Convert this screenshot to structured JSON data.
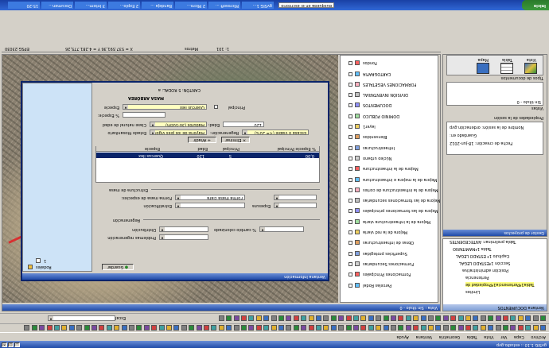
{
  "app": {
    "title": "gvSIG 1.10 :: estudio.gvp",
    "menu": [
      "Archivo",
      "Capa",
      "Ver",
      "Vista",
      "Tabla",
      "Geometría",
      "Ventana",
      "Ayuda"
    ],
    "scale_label": "Escala"
  },
  "view_window": {
    "title": "Vista : Sin título - 0",
    "status_scale": "1: 101",
    "status_units": "Metros",
    "status_coords": "X = 537.591,36   Y = 4.281.775,26",
    "status_crs": "EPSG:23030"
  },
  "project_manager": {
    "title": "Gestor de proyectos",
    "doc_types_label": "Tipos de documentos",
    "doc_types": [
      "Vista",
      "Tabla",
      "Mapa"
    ],
    "docs_label": "Vistas",
    "docs": [
      "Sin título - 0"
    ],
    "props_title": "Propiedades de la sesión",
    "props": [
      "Nombre de la sesión:  ordenación.gvp",
      "Guardado en:",
      "Fecha de creación:  18-jun-2012"
    ]
  },
  "docs_pane": {
    "title": "Ventana DOCUMENTOS",
    "tree": [
      "Tabla preliminar: ANTECEDENTES",
      "Tabla 1ªMAMITARIO",
      "Capítulo 1ª ESTADO LEGAL",
      "Sección 1ªESTADO LEGAL",
      "Posición administrativa",
      "Pertenencia",
      "Tabla1ªPertenencia1ªPropiedad de",
      "Límites"
    ]
  },
  "legend": {
    "header": "Fondos",
    "items": [
      "Fondos",
      "CARTOGRAFIA",
      "FORMACIONES VEGETALES",
      "DIVISIÓN INVENTARIAL",
      "DOCUMENTOS",
      "DOMINIO PÚBLICO",
      "layer1",
      "Bienvenidos",
      "Infraestructuras",
      "Núcleo urbano",
      "Mejora de la infraestructura",
      "Mejora de la mejora e infraestructura",
      "Mejora de la infraestructura de cortes",
      "Mejora de las formaciones secundarias",
      "Mejora de las formaciones principales",
      "Mejora de la infraestructura viaria",
      "Mejora de la red viaria",
      "Obras de infraestructuras",
      "Superficies protegidas",
      "Formaciones Secundarias",
      "Formaciones Principales",
      "Parcelas Rodal"
    ]
  },
  "dialog": {
    "title": "Ventana Información",
    "tree_root": "Rodales",
    "tree_child": "1",
    "breadcrumb": "CANTÓN: 5  RODAL: a",
    "section_title": "MASA ARBÓREA",
    "especie_label": "Especie",
    "especie_value": "Quercus ilex",
    "principal_label": "Principal",
    "pct_label": "% Especie:",
    "pct_value": "",
    "clase_label": "Clase natural de edad",
    "clase_value": "Maduros (30-50cm)",
    "edad_label": "Edad:",
    "edad_value": "120",
    "estado_label": "Estado fitosanitario",
    "estado_value": "Mayoría de los pies vigor...",
    "regeneracion_label": "Regeneración:",
    "regeneracion_value": "Escasa o viable (<= 20%)",
    "add_button": "Añadir",
    "delete_button": "Eliminar",
    "table_headers": [
      "Especie",
      "Edad",
      "Principal",
      "% Especie Principal"
    ],
    "table_rows": [
      [
        "Quercus ilex",
        "120",
        "S",
        "0,00"
      ]
    ],
    "estructura_title": "Estructura de masa",
    "forma_label": "Forma masa de especies:",
    "forma_value": "Forma masa clara",
    "estratificacion_label": "Estratificación",
    "espesura_label": "Espesura",
    "regen_section": "Regeneración",
    "distribucion_label": "Distribución",
    "cambio_label": "% cambio colonizado",
    "problemas_label": "Problemas regeneración",
    "save_button": "Guardar"
  },
  "taskbar": {
    "start": "Inicio",
    "search": "Búsqueda en el escritorio",
    "tasks": [
      "gvSIG 1...",
      "Microsoft ...",
      "2 Micro...",
      "Bandeja ...",
      "2 Explo...",
      "3 Intern...",
      "Documen...",
      "15:20"
    ]
  },
  "colors": {
    "title_blue": "#1f4aa8",
    "selection": "#0a246a",
    "field_yellow": "#ffffc0",
    "dialog_tree_bg": "#cde3f7",
    "map_base": "#8a8070"
  }
}
